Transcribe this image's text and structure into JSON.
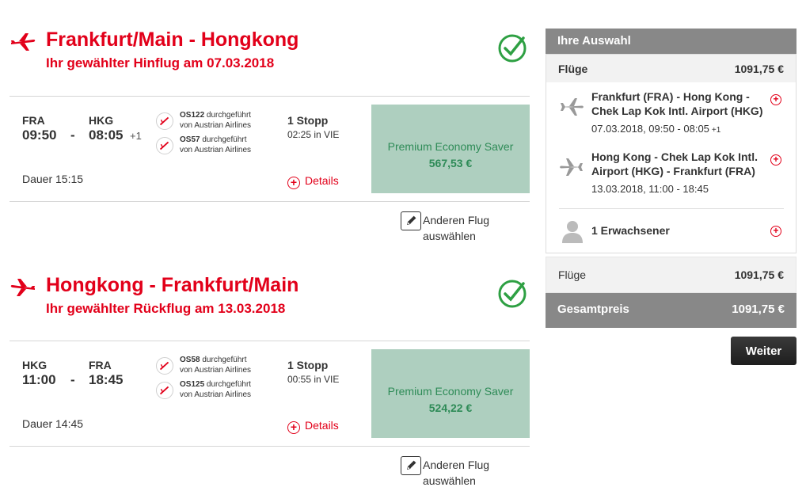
{
  "colors": {
    "brand_red": "#e2001a",
    "fare_green_bg": "#aecfbf",
    "fare_green_text": "#2e8b57",
    "check_green": "#2ea043",
    "sidebar_gray": "#888888"
  },
  "outbound": {
    "icon": "plane-takeoff-icon",
    "title": "Frankfurt/Main - Hongkong",
    "subtitle": "Ihr gewählter Hinflug am 07.03.2018",
    "dep_code": "FRA",
    "arr_code": "HKG",
    "dep_time": "09:50",
    "arr_time": "08:05",
    "dash": "-",
    "day_plus": "+1",
    "duration": "Dauer 15:15",
    "segments": [
      {
        "flight": "OS122",
        "line1_rest": "durchgeführt",
        "line2": "von Austrian Airlines"
      },
      {
        "flight": "OS57",
        "line1_rest": "durchgeführt",
        "line2": "von Austrian Airlines"
      }
    ],
    "stops": "1 Stopp",
    "stop_detail": "02:25 in VIE",
    "details_label": "Details",
    "fare_name": "Premium Economy Saver",
    "fare_price": "567,53 €",
    "change_label": "Anderen Flug auswählen"
  },
  "inbound": {
    "icon": "plane-landing-icon",
    "title": "Hongkong - Frankfurt/Main",
    "subtitle": "Ihr gewählter Rückflug am 13.03.2018",
    "dep_code": "HKG",
    "arr_code": "FRA",
    "dep_time": "11:00",
    "arr_time": "18:45",
    "dash": "-",
    "day_plus": "",
    "duration": "Dauer 14:45",
    "segments": [
      {
        "flight": "OS58",
        "line1_rest": "durchgeführt",
        "line2": "von Austrian Airlines"
      },
      {
        "flight": "OS125",
        "line1_rest": "durchgeführt",
        "line2": "von Austrian Airlines"
      }
    ],
    "stops": "1 Stopp",
    "stop_detail": "00:55 in VIE",
    "details_label": "Details",
    "fare_name": "Premium Economy Saver",
    "fare_price": "524,22 €",
    "change_label": "Anderen Flug auswählen"
  },
  "sidebar": {
    "header": "Ihre Auswahl",
    "flights_label": "Flüge",
    "flights_price": "1091,75 €",
    "segments": [
      {
        "route": "Frankfurt (FRA) - Hong Kong - Chek Lap Kok Intl. Airport (HKG)",
        "date": "07.03.2018, 09:50 - 08:05",
        "plus": "+1"
      },
      {
        "route": "Hong Kong - Chek Lap Kok Intl. Airport (HKG) - Frankfurt (FRA)",
        "date": "13.03.2018, 11:00 - 18:45",
        "plus": ""
      }
    ],
    "passengers": "1 Erwachsener",
    "summary_label": "Flüge",
    "summary_price": "1091,75 €",
    "total_label": "Gesamtpreis",
    "total_price": "1091,75 €"
  },
  "next_button": "Weiter"
}
